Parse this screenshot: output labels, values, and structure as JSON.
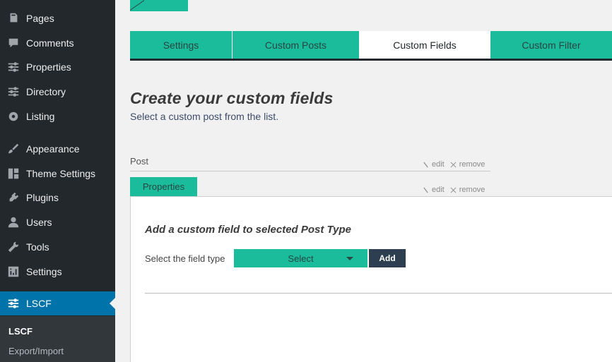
{
  "sidebar": {
    "items": [
      {
        "label": "Pages",
        "icon": "pages-icon"
      },
      {
        "label": "Comments",
        "icon": "comments-icon"
      },
      {
        "label": "Properties",
        "icon": "sliders-icon"
      },
      {
        "label": "Directory",
        "icon": "sliders-icon"
      },
      {
        "label": "Listing",
        "icon": "gear-icon"
      },
      {
        "label": "Appearance",
        "icon": "brush-icon"
      },
      {
        "label": "Theme Settings",
        "icon": "grid-icon"
      },
      {
        "label": "Plugins",
        "icon": "plug-icon"
      },
      {
        "label": "Users",
        "icon": "user-icon"
      },
      {
        "label": "Tools",
        "icon": "wrench-icon"
      },
      {
        "label": "Settings",
        "icon": "settings-icon"
      },
      {
        "label": "LSCF",
        "icon": "sliders-icon"
      }
    ],
    "submenu": [
      "LSCF",
      "Export/Import"
    ]
  },
  "tabs": [
    "Settings",
    "Custom Posts",
    "Custom Fields",
    "Custom Filter"
  ],
  "main": {
    "title": "Create your custom fields",
    "subtitle": "Select a custom post from the list.",
    "post_label": "Post",
    "edit_label": "edit",
    "remove_label": "remove",
    "properties_label": "Properties"
  },
  "panel": {
    "title": "Add a custom field to selected Post Type",
    "field_type_label": "Select the field type",
    "select_value": "Select",
    "add_label": "Add"
  },
  "colors": {
    "accent": "#1abc9c",
    "sidebar_bg": "#23282d",
    "active_menu": "#0073aa",
    "dark_button": "#2c3e50"
  }
}
